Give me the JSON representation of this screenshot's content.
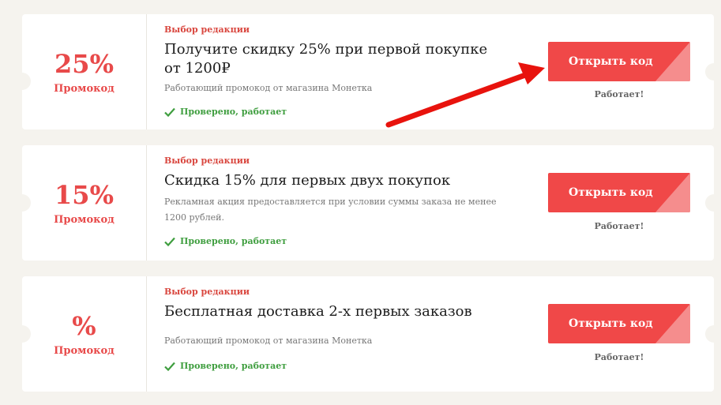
{
  "colors": {
    "accent": "#f04848",
    "discount": "#e84a4a",
    "verified": "#3f9e3f",
    "arrow": "#e8130d"
  },
  "coupons": [
    {
      "percent": "25%",
      "promo_label": "Промокод",
      "editor_choice": "Выбор редакции",
      "title": "Получите скидку 25% при первой покупке от 1200₽",
      "description": "Работающий промокод от магазина Монетка",
      "verified": "Проверено, работает",
      "button": "Открыть код",
      "status": "Работает!"
    },
    {
      "percent": "15%",
      "promo_label": "Промокод",
      "editor_choice": "Выбор редакции",
      "title": "Скидка 15% для первых двух покупок",
      "description": "Рекламная акция предоставляется при условии суммы заказа не менее 1200 рублей.",
      "verified": "Проверено, работает",
      "button": "Открыть код",
      "status": "Работает!"
    },
    {
      "percent": "%",
      "promo_label": "Промокод",
      "editor_choice": "Выбор редакции",
      "title": "Бесплатная доставка 2-х первых заказов",
      "description": "Работающий промокод от магазина Монетка",
      "verified": "Проверено, работает",
      "button": "Открыть код",
      "status": "Работает!"
    }
  ],
  "icons": {
    "check": "check-icon",
    "arrow": "red-arrow-annotation"
  }
}
